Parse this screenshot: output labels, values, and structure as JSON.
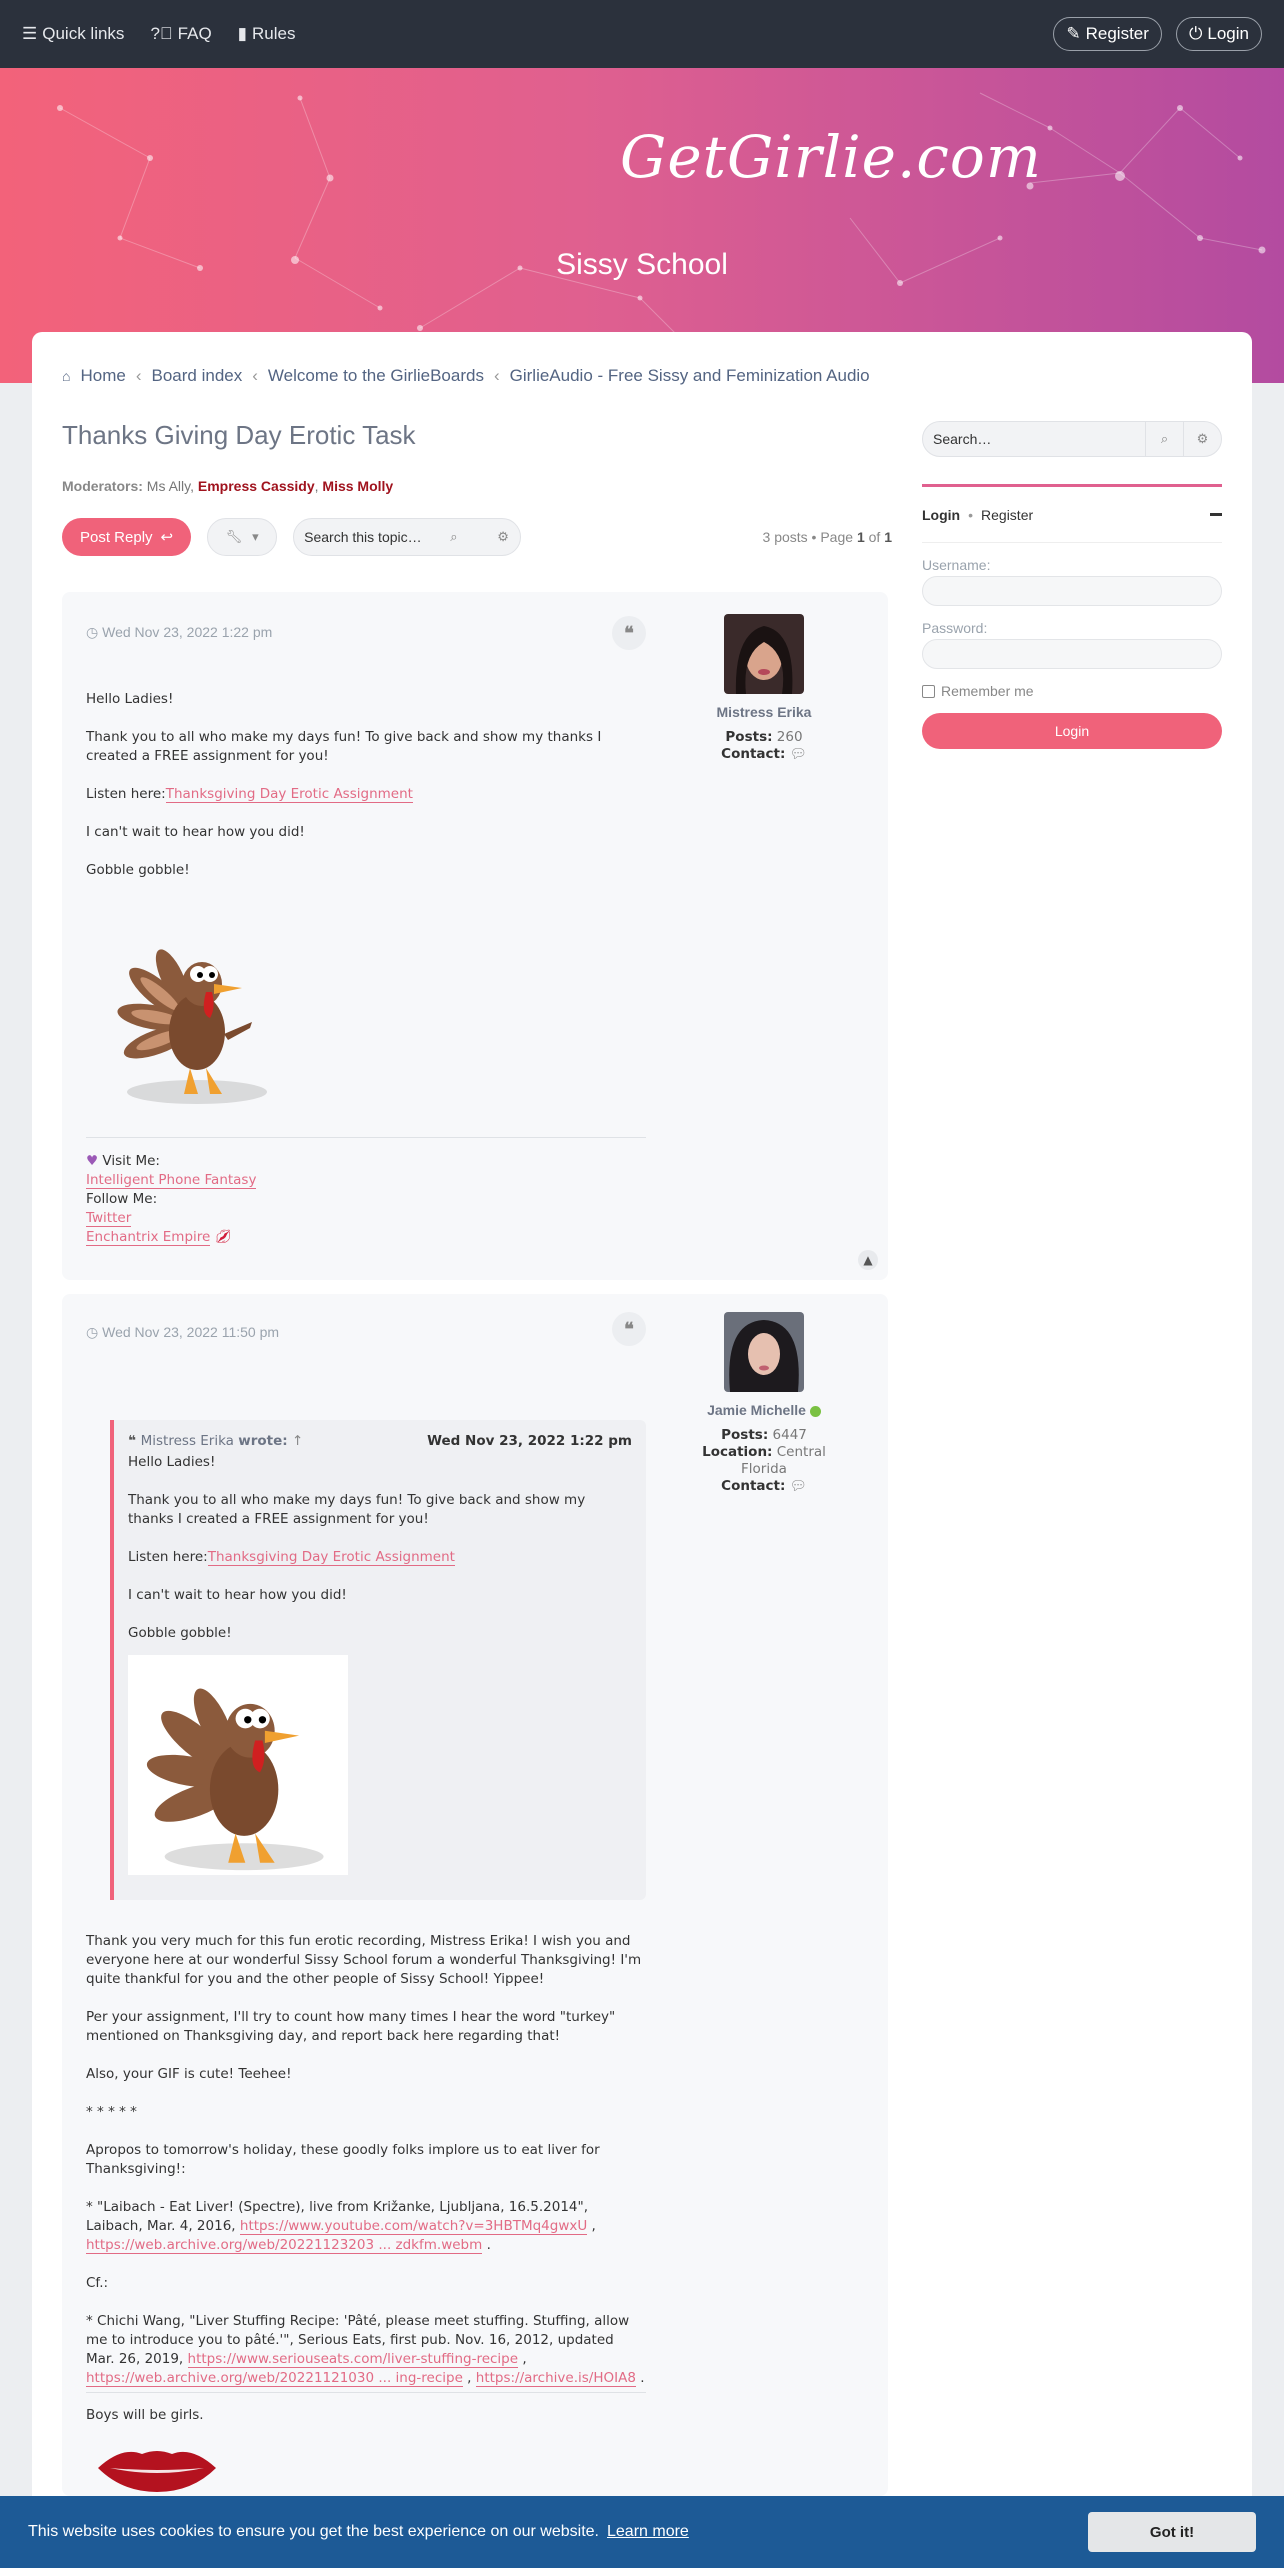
{
  "topbar": {
    "quick_links": "Quick links",
    "faq": "FAQ",
    "rules": "Rules",
    "register": "Register",
    "login": "Login"
  },
  "header": {
    "brand": "GetGirlie.com",
    "subtitle": "Sissy School",
    "colors": {
      "gradient_start": "#f3627a",
      "gradient_end": "#b34ba0"
    }
  },
  "breadcrumbs": [
    "Home",
    "Board index",
    "Welcome to the GirlieBoards",
    "GirlieAudio - Free Sissy and Feminization Audio"
  ],
  "topic": {
    "title": "Thanks Giving Day Erotic Task",
    "moderators_label": "Moderators:",
    "moderators": [
      "Ms Ally",
      "Empress Cassidy",
      "Miss Molly"
    ],
    "post_reply": "Post Reply",
    "search_placeholder": "Search this topic…",
    "posts_count": "3 posts",
    "page_label": "Page",
    "page_current": "1",
    "page_of": "of",
    "page_total": "1"
  },
  "posts": [
    {
      "date": "Wed Nov 23, 2022 1:22 pm",
      "author": "Mistress Erika",
      "posts_label": "Posts:",
      "posts_count": "260",
      "contact_label": "Contact:",
      "body": {
        "p1": "Hello Ladies!",
        "p2": "Thank you to all who make my days fun! To give back and show my thanks I created a FREE assignment for you!",
        "listen": "Listen here:",
        "link": "Thanksgiving Day Erotic Assignment",
        "p4": "I can't wait to hear how you did!",
        "p5": "Gobble gobble!"
      },
      "signature": {
        "visit": "Visit Me:",
        "link1": "Intelligent Phone Fantasy",
        "follow": "Follow Me:",
        "link2": "Twitter",
        "link3": "Enchantrix Empire"
      }
    },
    {
      "date": "Wed Nov 23, 2022 11:50 pm",
      "author": "Jamie Michelle",
      "posts_label": "Posts:",
      "posts_count": "6447",
      "location_label": "Location:",
      "location": "Central Florida",
      "contact_label": "Contact:",
      "quote": {
        "author": "Mistress Erika",
        "wrote": "wrote:",
        "arrow": "↑",
        "date": "Wed Nov 23, 2022 1:22 pm",
        "p1": "Hello Ladies!",
        "p2": "Thank you to all who make my days fun! To give back and show my thanks I created a FREE assignment for you!",
        "listen": "Listen here:",
        "link": "Thanksgiving Day Erotic Assignment",
        "p4": "I can't wait to hear how you did!",
        "p5": "Gobble gobble!"
      },
      "body": {
        "p1": "Thank you very much for this fun erotic recording, Mistress Erika! I wish you and everyone here at our wonderful Sissy School forum a wonderful Thanksgiving! I'm quite thankful for you and the other people of Sissy School! Yippee!",
        "p2": "Per your assignment, I'll try to count how many times I hear the word \"turkey\" mentioned on Thanksgiving day, and report back here regarding that!",
        "p3": "Also, your GIF is cute! Teehee!",
        "stars": "* * * * *",
        "p4": "Apropos to tomorrow's holiday, these goodly folks implore us to eat liver for Thanksgiving!:",
        "ref1_text": "* \"Laibach - Eat Liver! (Spectre), live from Križanke, Ljubljana, 16.5.2014\", Laibach, Mar. 4, 2016,",
        "ref1_link1": "https://www.youtube.com/watch?v=3HBTMq4gwxU",
        "ref1_link2": "https://web.archive.org/web/20221123203 ... zdkfm.webm",
        "cf": "Cf.:",
        "ref2_text": "* Chichi Wang, \"Liver Stuffing Recipe: 'Pâté, please meet stuffing. Stuffing, allow me to introduce you to pâté.'\", Serious Eats, first pub. Nov. 16, 2012, updated Mar. 26, 2019,",
        "ref2_link1": "https://www.seriouseats.com/liver-stuffing-recipe",
        "ref2_link2": "https://web.archive.org/web/20221121030 ... ing-recipe",
        "ref2_link3": "https://archive.is/HOIA8",
        "sig": "Boys will be girls."
      }
    }
  ],
  "sidebar": {
    "search_placeholder": "Search…",
    "login_tab": "Login",
    "register_tab": "Register",
    "username_label": "Username:",
    "password_label": "Password:",
    "remember": "Remember me",
    "login_button": "Login"
  },
  "cookie": {
    "message": "This website uses cookies to ensure you get the best experience on our website.",
    "learn_more": "Learn more",
    "got_it": "Got it!"
  }
}
